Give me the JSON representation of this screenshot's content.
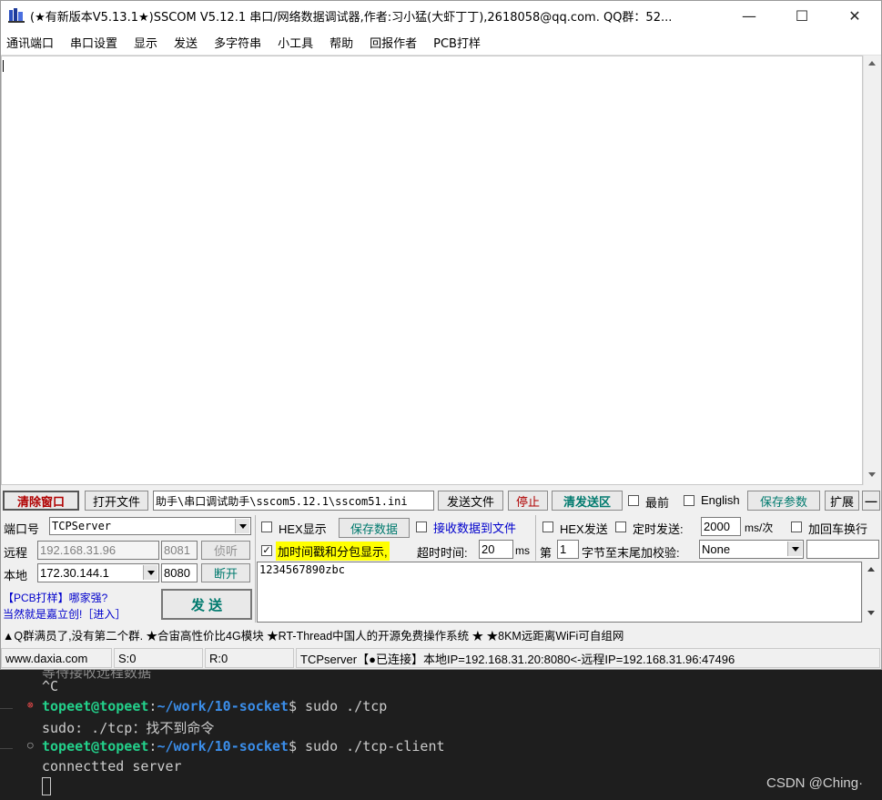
{
  "window": {
    "title": "(★有新版本V5.13.1★)SSCOM V5.12.1 串口/网络数据调试器,作者:习小猛(大虾丁丁),2618058@qq.com. QQ群：52...",
    "controls": {
      "minimize": "—",
      "maximize": "☐",
      "close": "✕"
    }
  },
  "menu": [
    "通讯端口",
    "串口设置",
    "显示",
    "发送",
    "多字符串",
    "小工具",
    "帮助",
    "回报作者",
    "PCB打样"
  ],
  "toolbar": {
    "clear_window": "清除窗口",
    "open_file": "打开文件",
    "file_path": "助手\\串口调试助手\\sscom5.12.1\\sscom51.ini",
    "send_file": "发送文件",
    "stop": "停止",
    "clear_send": "清发送区",
    "topmost_label": "最前",
    "english_label": "English",
    "save_params": "保存参数",
    "expand": "扩展",
    "collapse": "—"
  },
  "conn": {
    "port_label": "端口号",
    "port_value": "TCPServer",
    "remote_label": "远程",
    "remote_ip": "192.168.31.96",
    "remote_port": "8081",
    "listen_button": "侦听",
    "local_label": "本地",
    "local_ip": "172.30.144.1",
    "local_port": "8080",
    "disconnect_button": "断开",
    "ad_line1": "【PCB打样】哪家强?",
    "ad_line2": "当然就是嘉立创!［进入］",
    "send_button": "发  送"
  },
  "recv_opts": {
    "hex_display": "HEX显示",
    "save_data": "保存数据",
    "recv_to_file": "接收数据到文件",
    "timestamp": "加时间戳和分包显示,",
    "timeout_label": "超时时间:",
    "timeout_value": "20",
    "timeout_unit": "ms"
  },
  "send_opts": {
    "hex_send": "HEX发送",
    "timed_send": "定时发送:",
    "interval_value": "2000",
    "interval_unit": "ms/次",
    "add_crlf": "加回车换行",
    "nth_label": "第",
    "nth_value": "1",
    "checksum_label": "字节至末尾加校验:",
    "checksum_value": "None"
  },
  "send_text": "1234567890zbc",
  "marquee": "▲Q群满员了,没有第二个群. ★合宙高性价比4G模块 ★RT-Thread中国人的开源免费操作系统 ★ ★8KM远距离WiFi可自组网",
  "statusbar": {
    "website": "www.daxia.com",
    "sent": "S:0",
    "received": "R:0",
    "connection": "TCPserver【●已连接】本地IP=192.168.31.20:8080<-远程IP=192.168.31.96:47496"
  },
  "terminal": {
    "partial_line": "等待接收远程数据",
    "ctrl_c": "^C",
    "prompt_user": "topeet@topeet",
    "prompt_path": "~/work/10-socket",
    "cmd1": "sudo ./tcp",
    "err1": "sudo: ./tcp：找不到命令",
    "cmd2": "sudo ./tcp-client",
    "out2": "connectted server"
  },
  "watermark": "CSDN @Ching·",
  "colors": {
    "clear_red": "#b00000",
    "teal": "#007a6e",
    "blue_link": "#0000cc",
    "highlight": "#ffff00"
  }
}
